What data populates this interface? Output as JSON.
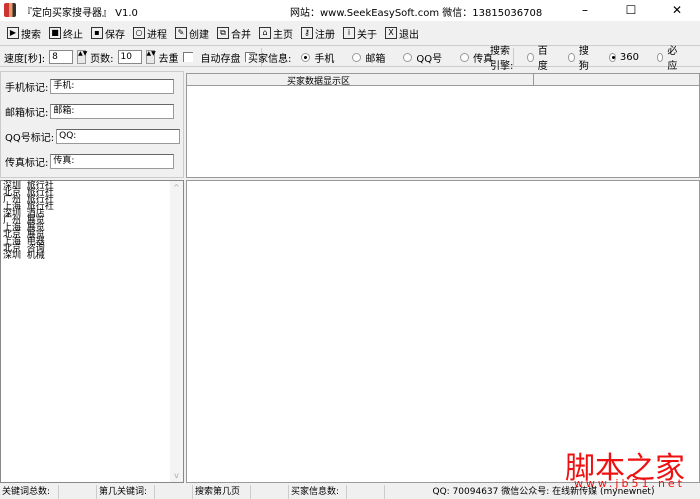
{
  "title": "『定向买家搜寻器』 V1.0",
  "site_info": "网站：www.SeekEasySoft.com  微信：13815036708",
  "window": {
    "minimize": "–",
    "maximize": "☐",
    "close": "✕"
  },
  "toolbar": [
    {
      "label": "搜索",
      "icon": "play-icon",
      "g": "▶"
    },
    {
      "label": "终止",
      "icon": "stop-icon",
      "g": "■"
    },
    {
      "label": "保存",
      "icon": "save-icon",
      "g": "▪"
    },
    {
      "label": "进程",
      "icon": "bulb-icon",
      "g": "○"
    },
    {
      "label": "创建",
      "icon": "create-icon",
      "g": "✎"
    },
    {
      "label": "合并",
      "icon": "merge-icon",
      "g": "⧉"
    },
    {
      "label": "主页",
      "icon": "home-icon",
      "g": "⌂"
    },
    {
      "label": "注册",
      "icon": "key-icon",
      "g": "⚷"
    },
    {
      "label": "关于",
      "icon": "about-icon",
      "g": "i"
    },
    {
      "label": "退出",
      "icon": "exit-icon",
      "g": "X"
    }
  ],
  "options": {
    "speed_label": "速度[秒]:",
    "speed_value": "8",
    "pages_label": "页数:",
    "pages_value": "10",
    "dedupe_label": "去重",
    "autosave_label": "自动存盘",
    "buyer_info_label": "买家信息:",
    "buyer_info": [
      {
        "label": "手机",
        "on": true
      },
      {
        "label": "邮箱",
        "on": false
      },
      {
        "label": "QQ号",
        "on": false
      },
      {
        "label": "传真",
        "on": false
      }
    ],
    "engine_label": "搜索引擎:",
    "engines": [
      {
        "label": "百度",
        "on": false
      },
      {
        "label": "搜狗",
        "on": false
      },
      {
        "label": "360",
        "on": true
      },
      {
        "label": "必应",
        "on": false
      }
    ]
  },
  "marks": [
    {
      "label": "手机标记:",
      "value": "手机:"
    },
    {
      "label": "邮箱标记:",
      "value": "邮箱:"
    },
    {
      "label": "QQ号标记:",
      "value": "QQ:"
    },
    {
      "label": "传真标记:",
      "value": "传真:"
    }
  ],
  "grid_header": "买家数据显示区",
  "keywords": [
    "深圳  旅行社",
    "北京  旅行社",
    "广州  旅行社",
    "上海  旅行社",
    "深圳  酒店",
    "广州  展览",
    "上海  展览",
    "北京  展览",
    "上海  电器",
    "北京  咨询",
    "深圳  机械"
  ],
  "status": {
    "kw_total": "关键词总数:",
    "kw_index": "第几关键词:",
    "page_index": "搜索第几页",
    "buyer_count": "买家信息数:",
    "contact": "QQ: 70094637 微信公众号: 在线新传媒 (mynewnet)"
  },
  "watermark": {
    "cn": "脚本之家",
    "url": "www.jb51.net"
  }
}
